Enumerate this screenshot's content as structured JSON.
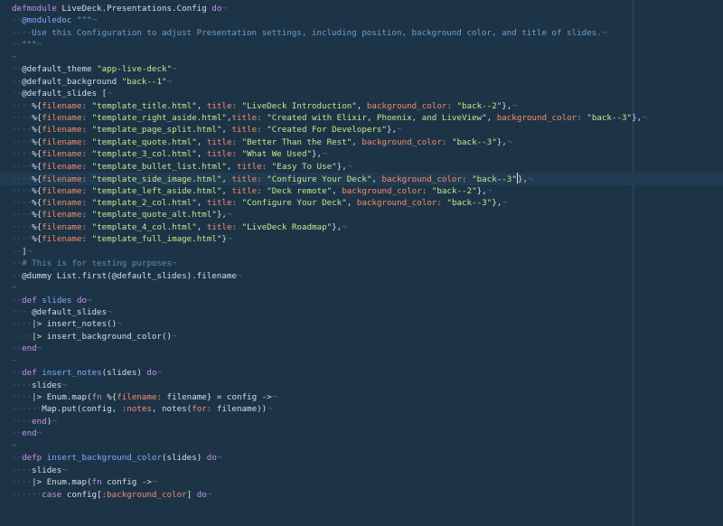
{
  "editor": {
    "lines": [
      [
        {
          "t": "defmodule",
          "c": "kw"
        },
        {
          "t": " LiveDeck.Presentations.Config "
        },
        {
          "t": "do",
          "c": "kw"
        },
        {
          "t": "¬",
          "c": "ws"
        }
      ],
      [
        {
          "t": "··",
          "c": "ws"
        },
        {
          "t": "@moduledoc",
          "c": "attr"
        },
        {
          "t": " \"\"\"",
          "c": "doc"
        },
        {
          "t": "¬",
          "c": "ws"
        }
      ],
      [
        {
          "t": "····",
          "c": "ws"
        },
        {
          "t": "Use this Configuration to adjust Presentation settings, including position, background color, and title of slides.",
          "c": "doc"
        },
        {
          "t": "¬",
          "c": "ws"
        }
      ],
      [
        {
          "t": "··",
          "c": "ws"
        },
        {
          "t": "\"\"\"",
          "c": "doc"
        },
        {
          "t": "¬",
          "c": "ws"
        }
      ],
      [
        {
          "t": "¬",
          "c": "ws"
        }
      ],
      [
        {
          "t": "··",
          "c": "ws"
        },
        {
          "t": "@default_theme "
        },
        {
          "t": "\"app-live-deck\"",
          "c": "str"
        },
        {
          "t": "¬",
          "c": "ws"
        }
      ],
      [
        {
          "t": "··",
          "c": "ws"
        },
        {
          "t": "@default_background "
        },
        {
          "t": "\"back--1\"",
          "c": "str"
        },
        {
          "t": "¬",
          "c": "ws"
        }
      ],
      [
        {
          "t": "··",
          "c": "ws"
        },
        {
          "t": "@default_slides ["
        },
        {
          "t": "¬",
          "c": "ws"
        }
      ],
      [
        {
          "t": "····",
          "c": "ws"
        },
        {
          "t": "%{"
        },
        {
          "t": "filename:",
          "c": "key"
        },
        {
          "t": " "
        },
        {
          "t": "\"template_title.html\"",
          "c": "str"
        },
        {
          "t": ", "
        },
        {
          "t": "title:",
          "c": "key"
        },
        {
          "t": " "
        },
        {
          "t": "\"LiveDeck Introduction\"",
          "c": "str"
        },
        {
          "t": ", "
        },
        {
          "t": "background_color:",
          "c": "key"
        },
        {
          "t": " "
        },
        {
          "t": "\"back--2\"",
          "c": "str"
        },
        {
          "t": "},"
        },
        {
          "t": "¬",
          "c": "ws"
        }
      ],
      [
        {
          "t": "····",
          "c": "ws"
        },
        {
          "t": "%{"
        },
        {
          "t": "filename:",
          "c": "key"
        },
        {
          "t": " "
        },
        {
          "t": "\"template_right_aside.html\"",
          "c": "str"
        },
        {
          "t": ","
        },
        {
          "t": "title:",
          "c": "key"
        },
        {
          "t": " "
        },
        {
          "t": "\"Created with Elixir, Phoenix, and LiveView\"",
          "c": "str"
        },
        {
          "t": ", "
        },
        {
          "t": "background_color:",
          "c": "key"
        },
        {
          "t": " "
        },
        {
          "t": "\"back--3\"",
          "c": "str"
        },
        {
          "t": "},"
        },
        {
          "t": "¬",
          "c": "ws"
        }
      ],
      [
        {
          "t": "····",
          "c": "ws"
        },
        {
          "t": "%{"
        },
        {
          "t": "filename:",
          "c": "key"
        },
        {
          "t": " "
        },
        {
          "t": "\"template_page_split.html\"",
          "c": "str"
        },
        {
          "t": ", "
        },
        {
          "t": "title:",
          "c": "key"
        },
        {
          "t": " "
        },
        {
          "t": "\"Created For Developers\"",
          "c": "str"
        },
        {
          "t": "},"
        },
        {
          "t": "¬",
          "c": "ws"
        }
      ],
      [
        {
          "t": "····",
          "c": "ws"
        },
        {
          "t": "%{"
        },
        {
          "t": "filename:",
          "c": "key"
        },
        {
          "t": " "
        },
        {
          "t": "\"template_quote.html\"",
          "c": "str"
        },
        {
          "t": ", "
        },
        {
          "t": "title:",
          "c": "key"
        },
        {
          "t": " "
        },
        {
          "t": "\"Better Than the Rest\"",
          "c": "str"
        },
        {
          "t": ", "
        },
        {
          "t": "background_color:",
          "c": "key"
        },
        {
          "t": " "
        },
        {
          "t": "\"back--3\"",
          "c": "str"
        },
        {
          "t": "},"
        },
        {
          "t": "¬",
          "c": "ws"
        }
      ],
      [
        {
          "t": "····",
          "c": "ws"
        },
        {
          "t": "%{"
        },
        {
          "t": "filename:",
          "c": "key"
        },
        {
          "t": " "
        },
        {
          "t": "\"template_3_col.html\"",
          "c": "str"
        },
        {
          "t": ", "
        },
        {
          "t": "title:",
          "c": "key"
        },
        {
          "t": " "
        },
        {
          "t": "\"What We Used\"",
          "c": "str"
        },
        {
          "t": "},"
        },
        {
          "t": "¬",
          "c": "ws"
        }
      ],
      [
        {
          "t": "····",
          "c": "ws"
        },
        {
          "t": "%{"
        },
        {
          "t": "filename:",
          "c": "key"
        },
        {
          "t": " "
        },
        {
          "t": "\"template_bullet_list.html\"",
          "c": "str"
        },
        {
          "t": ", "
        },
        {
          "t": "title:",
          "c": "key"
        },
        {
          "t": " "
        },
        {
          "t": "\"Easy To Use\"",
          "c": "str"
        },
        {
          "t": "},"
        },
        {
          "t": "¬",
          "c": "ws"
        }
      ],
      [
        {
          "t": "····",
          "c": "ws"
        },
        {
          "t": "%{"
        },
        {
          "t": "filename:",
          "c": "key"
        },
        {
          "t": " "
        },
        {
          "t": "\"template_side_image.html\"",
          "c": "str"
        },
        {
          "t": ", "
        },
        {
          "t": "title:",
          "c": "key"
        },
        {
          "t": " "
        },
        {
          "t": "\"Configure Your Deck\"",
          "c": "str"
        },
        {
          "t": ", "
        },
        {
          "t": "background_color:",
          "c": "key"
        },
        {
          "t": " "
        },
        {
          "t": "\"back--3\"",
          "c": "str"
        },
        {
          "cursor": true
        },
        {
          "t": "},"
        },
        {
          "t": "¬",
          "c": "ws"
        }
      ],
      [
        {
          "t": "····",
          "c": "ws"
        },
        {
          "t": "%{"
        },
        {
          "t": "filename:",
          "c": "key"
        },
        {
          "t": " "
        },
        {
          "t": "\"template_left_aside.html\"",
          "c": "str"
        },
        {
          "t": ", "
        },
        {
          "t": "title:",
          "c": "key"
        },
        {
          "t": " "
        },
        {
          "t": "\"Deck remote\"",
          "c": "str"
        },
        {
          "t": ", "
        },
        {
          "t": "background_color:",
          "c": "key"
        },
        {
          "t": " "
        },
        {
          "t": "\"back--2\"",
          "c": "str"
        },
        {
          "t": "},"
        },
        {
          "t": "¬",
          "c": "ws"
        }
      ],
      [
        {
          "t": "····",
          "c": "ws"
        },
        {
          "t": "%{"
        },
        {
          "t": "filename:",
          "c": "key"
        },
        {
          "t": " "
        },
        {
          "t": "\"template_2_col.html\"",
          "c": "str"
        },
        {
          "t": ", "
        },
        {
          "t": "title:",
          "c": "key"
        },
        {
          "t": " "
        },
        {
          "t": "\"Configure Your Deck\"",
          "c": "str"
        },
        {
          "t": ", "
        },
        {
          "t": "background_color:",
          "c": "key"
        },
        {
          "t": " "
        },
        {
          "t": "\"back--3\"",
          "c": "str"
        },
        {
          "t": "},"
        },
        {
          "t": "¬",
          "c": "ws"
        }
      ],
      [
        {
          "t": "····",
          "c": "ws"
        },
        {
          "t": "%{"
        },
        {
          "t": "filename:",
          "c": "key"
        },
        {
          "t": " "
        },
        {
          "t": "\"template_quote_alt.html\"",
          "c": "str"
        },
        {
          "t": "},"
        },
        {
          "t": "¬",
          "c": "ws"
        }
      ],
      [
        {
          "t": "····",
          "c": "ws"
        },
        {
          "t": "%{"
        },
        {
          "t": "filename:",
          "c": "key"
        },
        {
          "t": " "
        },
        {
          "t": "\"template_4_col.html\"",
          "c": "str"
        },
        {
          "t": ", "
        },
        {
          "t": "title:",
          "c": "key"
        },
        {
          "t": " "
        },
        {
          "t": "\"LiveDeck Roadmap\"",
          "c": "str"
        },
        {
          "t": "},"
        },
        {
          "t": "¬",
          "c": "ws"
        }
      ],
      [
        {
          "t": "····",
          "c": "ws"
        },
        {
          "t": "%{"
        },
        {
          "t": "filename:",
          "c": "key"
        },
        {
          "t": " "
        },
        {
          "t": "\"template_full_image.html\"",
          "c": "str"
        },
        {
          "t": "}"
        },
        {
          "t": "¬",
          "c": "ws"
        }
      ],
      [
        {
          "t": "··",
          "c": "ws"
        },
        {
          "t": "]"
        },
        {
          "t": "¬",
          "c": "ws"
        }
      ],
      [
        {
          "t": "··",
          "c": "ws"
        },
        {
          "t": "# This is for testing purposes",
          "c": "com"
        },
        {
          "t": "¬",
          "c": "ws"
        }
      ],
      [
        {
          "t": "··",
          "c": "ws"
        },
        {
          "t": "@dummy List.first(@default_slides).filename"
        },
        {
          "t": "¬",
          "c": "ws"
        }
      ],
      [
        {
          "t": "¬",
          "c": "ws"
        }
      ],
      [
        {
          "t": "··",
          "c": "ws"
        },
        {
          "t": "def",
          "c": "kw"
        },
        {
          "t": " "
        },
        {
          "t": "slides",
          "c": "attr"
        },
        {
          "t": " "
        },
        {
          "t": "do",
          "c": "kw"
        },
        {
          "t": "¬",
          "c": "ws"
        }
      ],
      [
        {
          "t": "····",
          "c": "ws"
        },
        {
          "t": "@default_slides"
        },
        {
          "t": "¬",
          "c": "ws"
        }
      ],
      [
        {
          "t": "····",
          "c": "ws"
        },
        {
          "t": "|> insert_notes()"
        },
        {
          "t": "¬",
          "c": "ws"
        }
      ],
      [
        {
          "t": "····",
          "c": "ws"
        },
        {
          "t": "|> insert_background_color()"
        },
        {
          "t": "¬",
          "c": "ws"
        }
      ],
      [
        {
          "t": "··",
          "c": "ws"
        },
        {
          "t": "end",
          "c": "kw"
        },
        {
          "t": "¬",
          "c": "ws"
        }
      ],
      [
        {
          "t": "¬",
          "c": "ws"
        }
      ],
      [
        {
          "t": "··",
          "c": "ws"
        },
        {
          "t": "def",
          "c": "kw"
        },
        {
          "t": " "
        },
        {
          "t": "insert_notes",
          "c": "attr"
        },
        {
          "t": "(slides) "
        },
        {
          "t": "do",
          "c": "kw"
        },
        {
          "t": "¬",
          "c": "ws"
        }
      ],
      [
        {
          "t": "····",
          "c": "ws"
        },
        {
          "t": "slides"
        },
        {
          "t": "¬",
          "c": "ws"
        }
      ],
      [
        {
          "t": "····",
          "c": "ws"
        },
        {
          "t": "|> Enum.map("
        },
        {
          "t": "fn",
          "c": "kw"
        },
        {
          "t": " %{"
        },
        {
          "t": "filename:",
          "c": "key"
        },
        {
          "t": " filename} = config ->"
        },
        {
          "t": "¬",
          "c": "ws"
        }
      ],
      [
        {
          "t": "······",
          "c": "ws"
        },
        {
          "t": "Map.put(config, "
        },
        {
          "t": ":notes",
          "c": "key"
        },
        {
          "t": ", notes("
        },
        {
          "t": "for:",
          "c": "key"
        },
        {
          "t": " filename))"
        },
        {
          "t": "¬",
          "c": "ws"
        }
      ],
      [
        {
          "t": "····",
          "c": "ws"
        },
        {
          "t": "end",
          "c": "kw"
        },
        {
          "t": ")"
        },
        {
          "t": "¬",
          "c": "ws"
        }
      ],
      [
        {
          "t": "··",
          "c": "ws"
        },
        {
          "t": "end",
          "c": "kw"
        },
        {
          "t": "¬",
          "c": "ws"
        }
      ],
      [
        {
          "t": "¬",
          "c": "ws"
        }
      ],
      [
        {
          "t": "··",
          "c": "ws"
        },
        {
          "t": "defp",
          "c": "kw"
        },
        {
          "t": " "
        },
        {
          "t": "insert_background_color",
          "c": "attr"
        },
        {
          "t": "(slides) "
        },
        {
          "t": "do",
          "c": "kw"
        },
        {
          "t": "¬",
          "c": "ws"
        }
      ],
      [
        {
          "t": "····",
          "c": "ws"
        },
        {
          "t": "slides"
        },
        {
          "t": "¬",
          "c": "ws"
        }
      ],
      [
        {
          "t": "····",
          "c": "ws"
        },
        {
          "t": "|> Enum.map("
        },
        {
          "t": "fn",
          "c": "kw"
        },
        {
          "t": " config ->"
        },
        {
          "t": "¬",
          "c": "ws"
        }
      ],
      [
        {
          "t": "······",
          "c": "ws"
        },
        {
          "t": "case",
          "c": "kw"
        },
        {
          "t": " config["
        },
        {
          "t": ":background_color",
          "c": "key"
        },
        {
          "t": "] "
        },
        {
          "t": "do",
          "c": "kw"
        },
        {
          "t": "¬",
          "c": "ws"
        }
      ]
    ],
    "current_line": 14
  }
}
